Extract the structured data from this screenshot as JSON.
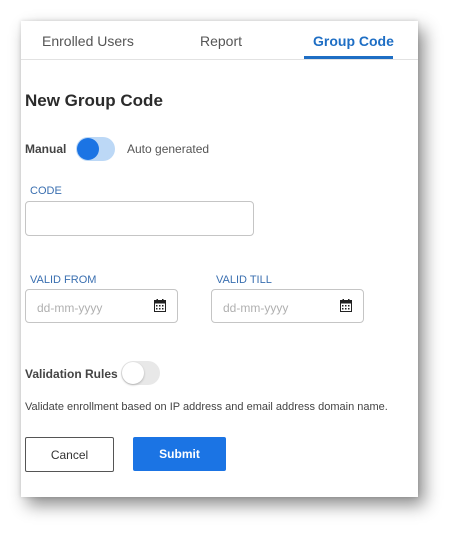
{
  "tabs": [
    {
      "label": "Enrolled Users"
    },
    {
      "label": "Report"
    },
    {
      "label": "Group Code"
    }
  ],
  "active_tab": "Group Code",
  "accent_color": "#1b74e4",
  "form": {
    "title": "New Group Code",
    "mode_toggle": {
      "left_label": "Manual",
      "right_label": "Auto generated",
      "state": "on"
    },
    "code": {
      "label": "CODE",
      "value": ""
    },
    "valid_from": {
      "label": "VALID FROM",
      "placeholder": "dd-mm-yyyy",
      "icon": "calendar-icon"
    },
    "valid_till": {
      "label": "VALID TILL",
      "placeholder": "dd-mm-yyyy",
      "icon": "calendar-icon"
    },
    "validation": {
      "label": "Validation Rules",
      "state": "off",
      "description": "Validate enrollment based on IP address and email address domain name."
    }
  },
  "buttons": {
    "cancel": "Cancel",
    "submit": "Submit"
  }
}
